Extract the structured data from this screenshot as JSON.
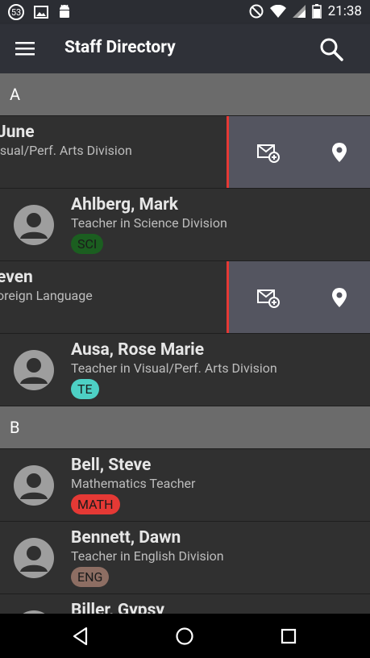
{
  "status_bar": {
    "notification_count": "53",
    "time": "21:38"
  },
  "app_bar": {
    "title": "Staff Directory"
  },
  "sections": [
    {
      "letter": "A",
      "items": [
        {
          "name": "June",
          "subtitle": "isual/Perf. Arts Division",
          "swiped": true
        },
        {
          "name": "Ahlberg, Mark",
          "subtitle": "Teacher in Science Division",
          "badge": "SCI",
          "badge_color": "#1b5e20"
        },
        {
          "name": "even",
          "subtitle": "oreign Language",
          "swiped": true
        },
        {
          "name": "Ausa, Rose Marie",
          "subtitle": "Teacher in Visual/Perf. Arts Division",
          "badge": "TE",
          "badge_color": "#4dd0c4"
        }
      ]
    },
    {
      "letter": "B",
      "items": [
        {
          "name": "Bell, Steve",
          "subtitle": "Mathematics Teacher",
          "badge": "MATH",
          "badge_color": "#e53935"
        },
        {
          "name": "Bennett, Dawn",
          "subtitle": "Teacher in English Division",
          "badge": "ENG",
          "badge_color": "#8d6e63"
        },
        {
          "name": "Biller, Gypsy",
          "subtitle": ""
        }
      ]
    }
  ],
  "icons": {
    "menu": "hamburger-icon",
    "search": "search-icon",
    "email": "email-add-icon",
    "location": "location-pin-icon",
    "avatar": "person-avatar-icon",
    "nav_back": "back-triangle-icon",
    "nav_home": "home-circle-icon",
    "nav_recents": "recents-square-icon"
  }
}
